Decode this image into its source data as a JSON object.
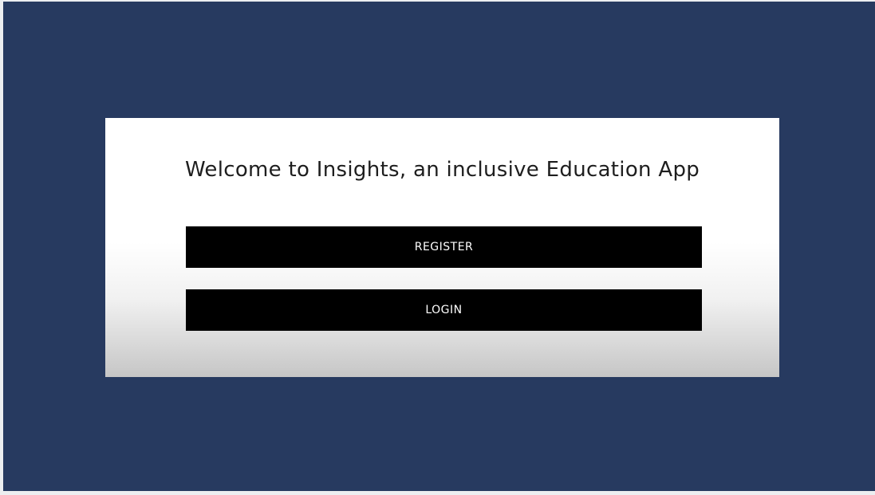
{
  "welcome": {
    "title": "Welcome to Insights, an inclusive Education App"
  },
  "actions": {
    "register_label": "REGISTER",
    "login_label": "LOGIN"
  },
  "colors": {
    "background": "#273a60",
    "card": "#ffffff",
    "button": "#000000",
    "button_text": "#ffffff"
  }
}
